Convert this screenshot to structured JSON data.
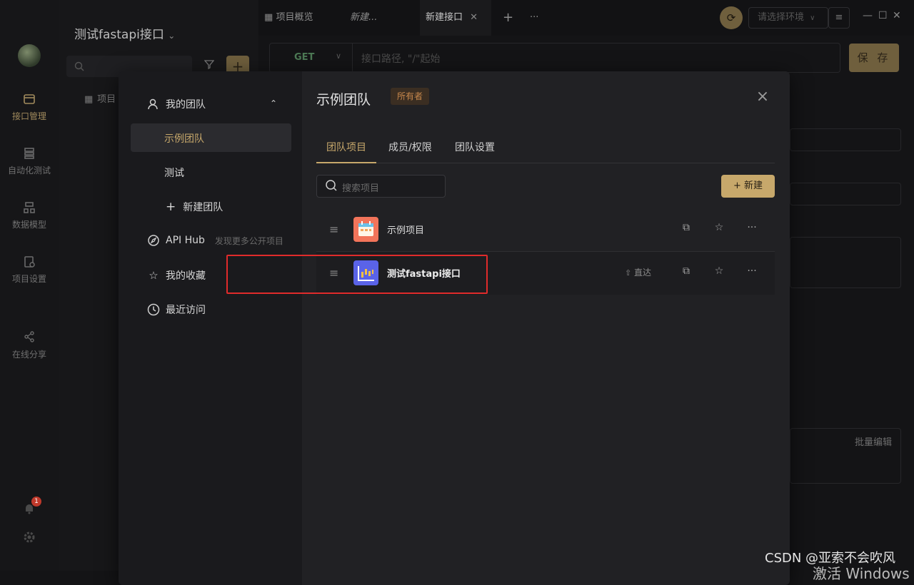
{
  "rail": {
    "items": [
      {
        "label": "接口管理",
        "icon": "api-management-icon"
      },
      {
        "label": "自动化测试",
        "icon": "automation-test-icon"
      },
      {
        "label": "数据模型",
        "icon": "data-model-icon"
      },
      {
        "label": "项目设置",
        "icon": "project-settings-icon"
      },
      {
        "label": "在线分享",
        "icon": "share-icon"
      }
    ],
    "notification_count": "1"
  },
  "sidebar": {
    "project_title": "测试fastapi接口",
    "list_item": "项目"
  },
  "topbar": {
    "tabs": [
      {
        "label": "项目概览"
      },
      {
        "label": "新建..."
      },
      {
        "label": "新建接口"
      }
    ],
    "add_tab": "+",
    "more_tabs": "···",
    "env_placeholder": "请选择环境"
  },
  "request": {
    "method": "GET",
    "url_placeholder": "接口路径, \"/\"起始",
    "save_label": "保 存",
    "bulk_edit": "批量编辑"
  },
  "modal": {
    "side": {
      "my_teams": "我的团队",
      "teams": [
        {
          "label": "示例团队",
          "selected": true
        },
        {
          "label": "测试",
          "selected": false
        }
      ],
      "new_team": "新建团队",
      "api_hub": "API Hub",
      "api_hub_hint": "发现更多公开项目",
      "favorites": "我的收藏",
      "recent": "最近访问"
    },
    "team_title": "示例团队",
    "owner_badge": "所有者",
    "tabs": [
      {
        "label": "团队项目",
        "active": true
      },
      {
        "label": "成员/权限",
        "active": false
      },
      {
        "label": "团队设置",
        "active": false
      }
    ],
    "search_placeholder": "搜索项目",
    "new_button": "新建",
    "projects": [
      {
        "name": "示例项目",
        "icon": "calendar-project-icon",
        "direct": ""
      },
      {
        "name": "测试fastapi接口",
        "icon": "chart-project-icon",
        "direct": "直达"
      }
    ]
  },
  "watermark": {
    "csdn": "CSDN @亚索不会吹风",
    "windows": "激活 Windows"
  },
  "colors": {
    "accent": "#c7a86b",
    "owner_badge_bg": "#3b2e22",
    "owner_badge_text": "#c8884c",
    "highlight_box": "#e02b2b"
  }
}
